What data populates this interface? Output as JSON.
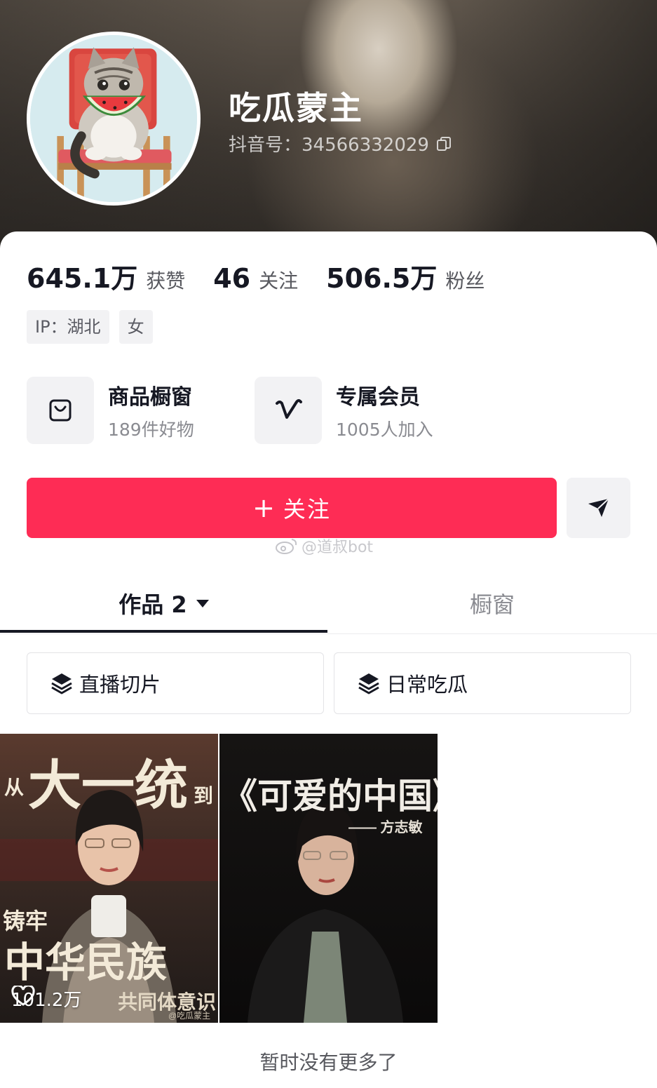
{
  "profile": {
    "nickname": "吃瓜蒙主",
    "douyin_id": "抖音号：34566332029"
  },
  "stats": [
    {
      "value": "645.1万",
      "label": "获赞"
    },
    {
      "value": "46",
      "label": "关注"
    },
    {
      "value": "506.5万",
      "label": "粉丝"
    }
  ],
  "tags": [
    "IP：湖北",
    "女"
  ],
  "shortcuts": [
    {
      "title": "商品橱窗",
      "subtitle": "189件好物",
      "icon": "shopping-bag-icon"
    },
    {
      "title": "专属会员",
      "subtitle": "1005人加入",
      "icon": "v-membership-icon"
    }
  ],
  "actions": {
    "follow_plus": "+",
    "follow_label": "关注",
    "share_icon": "send-icon"
  },
  "watermark": "@道叔bot",
  "tabs": {
    "works_label": "作品 2",
    "shop_label": "橱窗"
  },
  "collections": [
    "直播切片",
    "日常吃瓜"
  ],
  "videos": [
    {
      "cover_text": {
        "line1_small": "从",
        "line1_big": "大一统",
        "line1_end": "到",
        "line2_small": "铸牢",
        "line2_big": "中华民族",
        "line3": "共同体意识",
        "credit": "@吃瓜蒙主"
      },
      "likes": "101.2万"
    },
    {
      "cover_text": {
        "title": "《可爱的中国》",
        "author": "—— 方志敏"
      }
    }
  ],
  "footer": "暂时没有更多了",
  "colors": {
    "accent": "#fe2c55",
    "text_primary": "#161823",
    "text_secondary": "#8a8b91"
  }
}
